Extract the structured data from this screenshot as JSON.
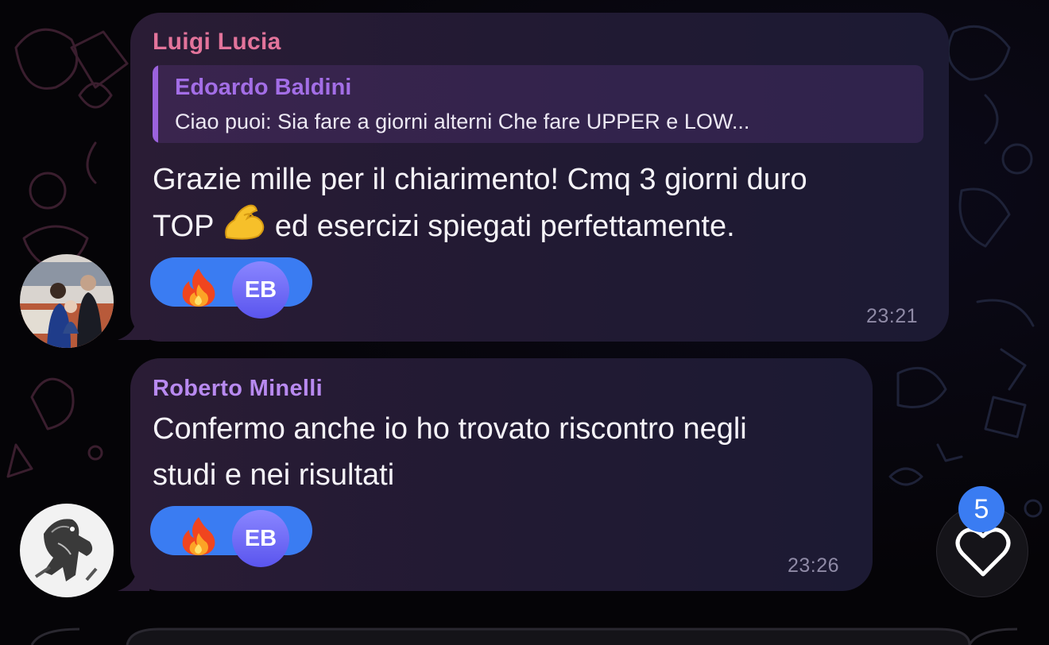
{
  "messages": [
    {
      "sender": "Luigi Lucia",
      "sender_color": "#e3749b",
      "reply": {
        "name": "Edoardo Baldini",
        "text": "Ciao puoi: Sia fare a giorni alterni Che fare UPPER e LOW..."
      },
      "text_line1": "Grazie mille per il chiarimento! Cmq 3 giorni duro",
      "text_line2_a": "TOP",
      "text_line2_emoji": "flexed-biceps",
      "text_line2_b": " ed esercizi spiegati perfettamente.",
      "reaction": {
        "emoji": "fire",
        "avatar_initials": "EB"
      },
      "time": "23:21"
    },
    {
      "sender": "Roberto Minelli",
      "sender_color": "#b88af0",
      "text_line1": "Confermo anche io ho trovato riscontro negli",
      "text_line2": "studi e nei risultati",
      "reaction": {
        "emoji": "fire",
        "avatar_initials": "EB"
      },
      "time": "23:26"
    }
  ],
  "reactions_button": {
    "icon": "heart-icon",
    "count": "5"
  },
  "colors": {
    "accent": "#3a7cf2",
    "bubble": "#221a33",
    "background": "#060508"
  }
}
